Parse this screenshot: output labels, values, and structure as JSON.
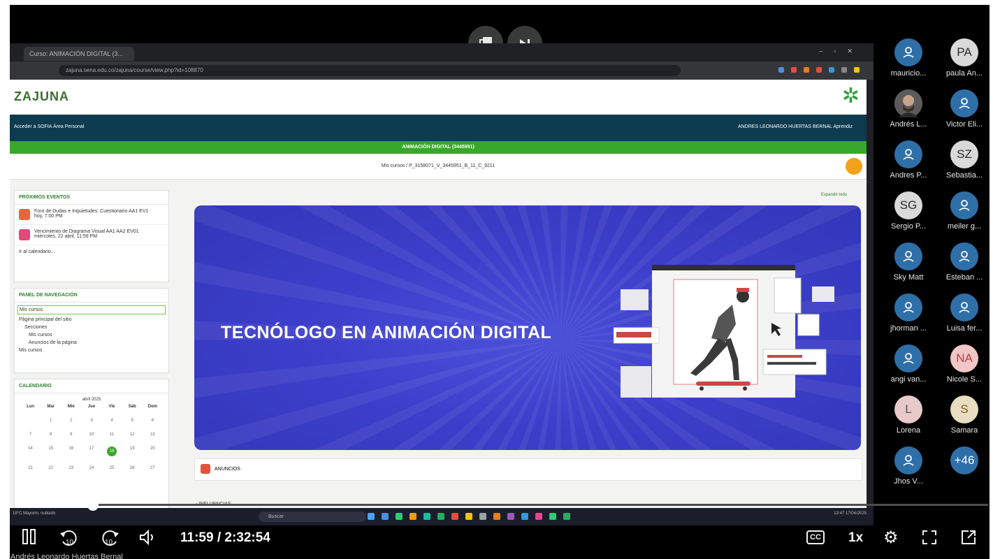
{
  "browser": {
    "tab_title": "Curso: ANIMACIÓN DIGITAL (3...",
    "url": "zajuna.sena.edu.co/zajuna/course/view.php?id=108870"
  },
  "site": {
    "logo": "ZAJUNA",
    "nav_links": "Acceder a SOFIA   Área Personal",
    "user": "ANDRES LEONARDO HUERTAS BERNAL Aprendiz",
    "course_title": "ANIMACIÓN DIGITAL (3445951)",
    "breadcrumb": "Mis cursos  /  P_3158071_V_3445951_B_11_C_9211"
  },
  "events_block": {
    "title": "PRÓXIMOS EVENTOS",
    "items": [
      {
        "text": "Foro de Dudas e Inquietudes: Cuestionario AA1 EV1",
        "time": "hoy, 7:00 PM"
      },
      {
        "text": "Vencimiento de Diagrama Visual AA1 AA2 EV01",
        "time": "miércoles, 22 abril, 11:59 PM"
      }
    ],
    "link": "Ir al calendario..."
  },
  "nav_block": {
    "title": "PANEL DE NAVEGACIÓN",
    "items": [
      "Mis cursos",
      "Página principal del sitio",
      "Secciones",
      "Mis cursos",
      "Anuncios de la página",
      "Mis cursos"
    ]
  },
  "calendar_block": {
    "title": "CALENDARIO",
    "month": "abril 2025",
    "days": [
      "Lun",
      "Mar",
      "Mié",
      "Jue",
      "Vie",
      "Sáb",
      "Dom"
    ],
    "rows": [
      [
        "",
        "1",
        "2",
        "3",
        "4",
        "5",
        "6"
      ],
      [
        "7",
        "8",
        "9",
        "10",
        "11",
        "12",
        "13"
      ],
      [
        "14",
        "15",
        "16",
        "17",
        "18",
        "19",
        "20"
      ],
      [
        "21",
        "22",
        "23",
        "24",
        "25",
        "26",
        "27"
      ]
    ],
    "today": "18"
  },
  "main": {
    "expand_all": "Expandir todo",
    "banner_title": "TECNÓLOGO EN ANIMACIÓN DIGITAL",
    "anuncios": "ANUNCIOS",
    "section_1": "INFLUENCIAS"
  },
  "taskbar": {
    "weather": "18°C Mayorm. nublado",
    "search_placeholder": "Buscar",
    "clock": "13:47 17/04/2025"
  },
  "participants": [
    {
      "initials": "",
      "name": "mauricio...",
      "type": "icon"
    },
    {
      "initials": "PA",
      "name": "paula An...",
      "type": "letters"
    },
    {
      "initials": "",
      "name": "Andrés L...",
      "type": "photo"
    },
    {
      "initials": "",
      "name": "Victor Eli...",
      "type": "icon"
    },
    {
      "initials": "",
      "name": "Andres P...",
      "type": "icon"
    },
    {
      "initials": "SZ",
      "name": "Sebastia...",
      "type": "letters"
    },
    {
      "initials": "SG",
      "name": "Sergio P...",
      "type": "letters"
    },
    {
      "initials": "",
      "name": "meiler g...",
      "type": "icon"
    },
    {
      "initials": "",
      "name": "Sky Matt",
      "type": "icon"
    },
    {
      "initials": "",
      "name": "Esteban ...",
      "type": "icon"
    },
    {
      "initials": "",
      "name": "jhorman ...",
      "type": "icon"
    },
    {
      "initials": "",
      "name": "Luisa fer...",
      "type": "icon"
    },
    {
      "initials": "",
      "name": "angi van...",
      "type": "icon"
    },
    {
      "initials": "NA",
      "name": "Nicole S...",
      "type": "na"
    },
    {
      "initials": "L",
      "name": "Lorena",
      "type": "l"
    },
    {
      "initials": "S",
      "name": "Samara",
      "type": "s"
    },
    {
      "initials": "",
      "name": "Jhos V...",
      "type": "icon"
    },
    {
      "initials": "+46",
      "name": "",
      "type": "icon"
    }
  ],
  "player": {
    "time": "11:59 / 2:32:54",
    "speed": "1x",
    "cc": "CC",
    "presenter": "Andrés Leonardo Huertas Bernal",
    "progress_fraction": 0.077
  }
}
